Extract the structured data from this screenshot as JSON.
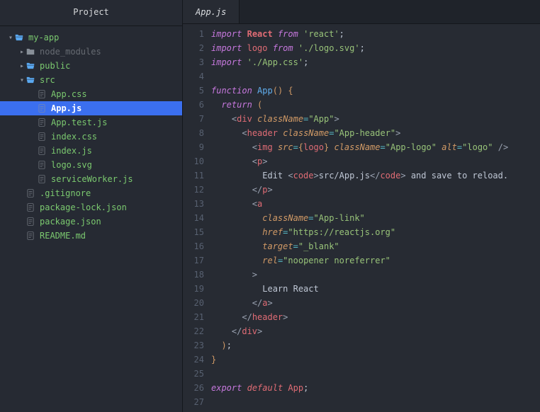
{
  "sidebar": {
    "title": "Project",
    "tree": [
      {
        "depth": 0,
        "kind": "folder-open",
        "caret": "down",
        "label": "my-app",
        "style": "green"
      },
      {
        "depth": 1,
        "kind": "folder-closed",
        "caret": "right",
        "label": "node_modules",
        "style": "dim"
      },
      {
        "depth": 1,
        "kind": "folder-open",
        "caret": "right",
        "label": "public",
        "style": "green"
      },
      {
        "depth": 1,
        "kind": "folder-open",
        "caret": "down",
        "label": "src",
        "style": "green"
      },
      {
        "depth": 2,
        "kind": "file",
        "caret": "",
        "label": "App.css",
        "style": "green"
      },
      {
        "depth": 2,
        "kind": "file",
        "caret": "",
        "label": "App.js",
        "style": "green",
        "selected": true
      },
      {
        "depth": 2,
        "kind": "file",
        "caret": "",
        "label": "App.test.js",
        "style": "green"
      },
      {
        "depth": 2,
        "kind": "file",
        "caret": "",
        "label": "index.css",
        "style": "green"
      },
      {
        "depth": 2,
        "kind": "file",
        "caret": "",
        "label": "index.js",
        "style": "green"
      },
      {
        "depth": 2,
        "kind": "file",
        "caret": "",
        "label": "logo.svg",
        "style": "green"
      },
      {
        "depth": 2,
        "kind": "file",
        "caret": "",
        "label": "serviceWorker.js",
        "style": "green"
      },
      {
        "depth": 1,
        "kind": "file",
        "caret": "",
        "label": ".gitignore",
        "style": "green"
      },
      {
        "depth": 1,
        "kind": "file",
        "caret": "",
        "label": "package-lock.json",
        "style": "green"
      },
      {
        "depth": 1,
        "kind": "file",
        "caret": "",
        "label": "package.json",
        "style": "green"
      },
      {
        "depth": 1,
        "kind": "file",
        "caret": "",
        "label": "README.md",
        "style": "green"
      }
    ]
  },
  "editor": {
    "tab": "App.js",
    "lines": [
      [
        {
          "c": "kw-import",
          "t": "import"
        },
        {
          "c": "punct",
          "t": " "
        },
        {
          "c": "ident-b",
          "t": "React"
        },
        {
          "c": "punct",
          "t": " "
        },
        {
          "c": "kw-from",
          "t": "from"
        },
        {
          "c": "punct",
          "t": " "
        },
        {
          "c": "str",
          "t": "'react'"
        },
        {
          "c": "punct",
          "t": ";"
        }
      ],
      [
        {
          "c": "kw-import",
          "t": "import"
        },
        {
          "c": "punct",
          "t": " "
        },
        {
          "c": "ident",
          "t": "logo"
        },
        {
          "c": "punct",
          "t": " "
        },
        {
          "c": "kw-from",
          "t": "from"
        },
        {
          "c": "punct",
          "t": " "
        },
        {
          "c": "str",
          "t": "'./logo.svg'"
        },
        {
          "c": "punct",
          "t": ";"
        }
      ],
      [
        {
          "c": "kw-import",
          "t": "import"
        },
        {
          "c": "punct",
          "t": " "
        },
        {
          "c": "str",
          "t": "'./App.css'"
        },
        {
          "c": "punct",
          "t": ";"
        }
      ],
      [],
      [
        {
          "c": "kw-function",
          "t": "function"
        },
        {
          "c": "punct",
          "t": " "
        },
        {
          "c": "fn-name",
          "t": "App"
        },
        {
          "c": "brace",
          "t": "()"
        },
        {
          "c": "punct",
          "t": " "
        },
        {
          "c": "brace",
          "t": "{"
        }
      ],
      [
        {
          "c": "punct",
          "t": "  "
        },
        {
          "c": "kw-return",
          "t": "return"
        },
        {
          "c": "punct",
          "t": " "
        },
        {
          "c": "brace",
          "t": "("
        }
      ],
      [
        {
          "c": "punct",
          "t": "    "
        },
        {
          "c": "tagbr",
          "t": "<"
        },
        {
          "c": "tagname",
          "t": "div"
        },
        {
          "c": "punct",
          "t": " "
        },
        {
          "c": "attr",
          "t": "className"
        },
        {
          "c": "op",
          "t": "="
        },
        {
          "c": "str",
          "t": "\"App\""
        },
        {
          "c": "tagbr",
          "t": ">"
        }
      ],
      [
        {
          "c": "punct",
          "t": "      "
        },
        {
          "c": "tagbr",
          "t": "<"
        },
        {
          "c": "tagname",
          "t": "header"
        },
        {
          "c": "punct",
          "t": " "
        },
        {
          "c": "attr",
          "t": "className"
        },
        {
          "c": "op",
          "t": "="
        },
        {
          "c": "str",
          "t": "\"App-header\""
        },
        {
          "c": "tagbr",
          "t": ">"
        }
      ],
      [
        {
          "c": "punct",
          "t": "        "
        },
        {
          "c": "tagbr",
          "t": "<"
        },
        {
          "c": "tagname",
          "t": "img"
        },
        {
          "c": "punct",
          "t": " "
        },
        {
          "c": "attr",
          "t": "src"
        },
        {
          "c": "op",
          "t": "="
        },
        {
          "c": "brace",
          "t": "{"
        },
        {
          "c": "jsxexpr",
          "t": "logo"
        },
        {
          "c": "brace",
          "t": "}"
        },
        {
          "c": "punct",
          "t": " "
        },
        {
          "c": "attr",
          "t": "className"
        },
        {
          "c": "op",
          "t": "="
        },
        {
          "c": "str",
          "t": "\"App-logo\""
        },
        {
          "c": "punct",
          "t": " "
        },
        {
          "c": "attr",
          "t": "alt"
        },
        {
          "c": "op",
          "t": "="
        },
        {
          "c": "str",
          "t": "\"logo\""
        },
        {
          "c": "punct",
          "t": " "
        },
        {
          "c": "tagbr",
          "t": "/>"
        }
      ],
      [
        {
          "c": "punct",
          "t": "        "
        },
        {
          "c": "tagbr",
          "t": "<"
        },
        {
          "c": "tagname",
          "t": "p"
        },
        {
          "c": "tagbr",
          "t": ">"
        }
      ],
      [
        {
          "c": "punct",
          "t": "          "
        },
        {
          "c": "txt",
          "t": "Edit "
        },
        {
          "c": "tagbr",
          "t": "<"
        },
        {
          "c": "tagname",
          "t": "code"
        },
        {
          "c": "tagbr",
          "t": ">"
        },
        {
          "c": "txt",
          "t": "src/App.js"
        },
        {
          "c": "tagbr",
          "t": "</"
        },
        {
          "c": "tagname",
          "t": "code"
        },
        {
          "c": "tagbr",
          "t": ">"
        },
        {
          "c": "txt",
          "t": " and save to reload."
        }
      ],
      [
        {
          "c": "punct",
          "t": "        "
        },
        {
          "c": "tagbr",
          "t": "</"
        },
        {
          "c": "tagname",
          "t": "p"
        },
        {
          "c": "tagbr",
          "t": ">"
        }
      ],
      [
        {
          "c": "punct",
          "t": "        "
        },
        {
          "c": "tagbr",
          "t": "<"
        },
        {
          "c": "tagname",
          "t": "a"
        }
      ],
      [
        {
          "c": "punct",
          "t": "          "
        },
        {
          "c": "attr",
          "t": "className"
        },
        {
          "c": "op",
          "t": "="
        },
        {
          "c": "str",
          "t": "\"App-link\""
        }
      ],
      [
        {
          "c": "punct",
          "t": "          "
        },
        {
          "c": "attr",
          "t": "href"
        },
        {
          "c": "op",
          "t": "="
        },
        {
          "c": "str",
          "t": "\"https://reactjs.org\""
        }
      ],
      [
        {
          "c": "punct",
          "t": "          "
        },
        {
          "c": "attr",
          "t": "target"
        },
        {
          "c": "op",
          "t": "="
        },
        {
          "c": "str",
          "t": "\"_blank\""
        }
      ],
      [
        {
          "c": "punct",
          "t": "          "
        },
        {
          "c": "attr",
          "t": "rel"
        },
        {
          "c": "op",
          "t": "="
        },
        {
          "c": "str",
          "t": "\"noopener noreferrer\""
        }
      ],
      [
        {
          "c": "punct",
          "t": "        "
        },
        {
          "c": "tagbr",
          "t": ">"
        }
      ],
      [
        {
          "c": "punct",
          "t": "          "
        },
        {
          "c": "txt",
          "t": "Learn React"
        }
      ],
      [
        {
          "c": "punct",
          "t": "        "
        },
        {
          "c": "tagbr",
          "t": "</"
        },
        {
          "c": "tagname",
          "t": "a"
        },
        {
          "c": "tagbr",
          "t": ">"
        }
      ],
      [
        {
          "c": "punct",
          "t": "      "
        },
        {
          "c": "tagbr",
          "t": "</"
        },
        {
          "c": "tagname",
          "t": "header"
        },
        {
          "c": "tagbr",
          "t": ">"
        }
      ],
      [
        {
          "c": "punct",
          "t": "    "
        },
        {
          "c": "tagbr",
          "t": "</"
        },
        {
          "c": "tagname",
          "t": "div"
        },
        {
          "c": "tagbr",
          "t": ">"
        }
      ],
      [
        {
          "c": "punct",
          "t": "  "
        },
        {
          "c": "brace",
          "t": ")"
        },
        {
          "c": "punct",
          "t": ";"
        }
      ],
      [
        {
          "c": "brace",
          "t": "}"
        }
      ],
      [],
      [
        {
          "c": "kw-export",
          "t": "export"
        },
        {
          "c": "punct",
          "t": " "
        },
        {
          "c": "kw-default",
          "t": "default"
        },
        {
          "c": "punct",
          "t": " "
        },
        {
          "c": "ident",
          "t": "App"
        },
        {
          "c": "punct",
          "t": ";"
        }
      ],
      []
    ]
  }
}
